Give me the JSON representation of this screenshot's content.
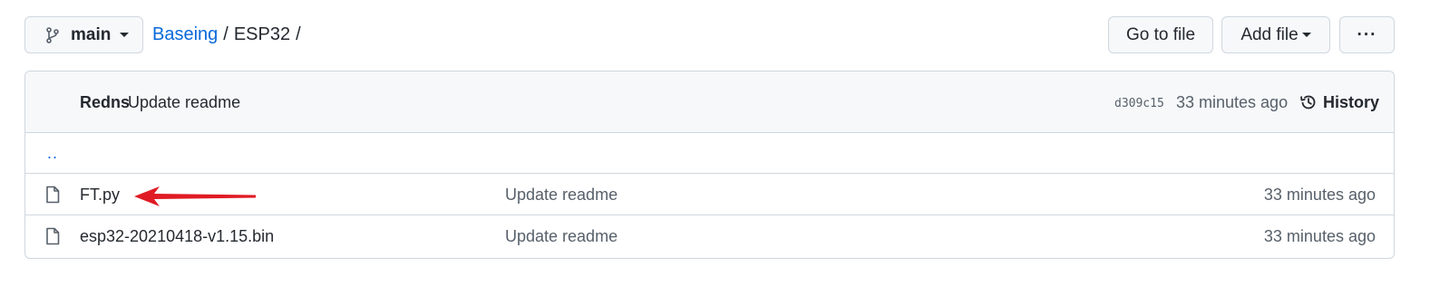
{
  "branch": {
    "name": "main"
  },
  "breadcrumb": {
    "repo": "Baseing",
    "separator": "/",
    "dir": "ESP32",
    "trailing": "/"
  },
  "actions": {
    "go_to_file": "Go to file",
    "add_file": "Add file",
    "more": "···"
  },
  "latest_commit": {
    "author": "Redns",
    "message": "Update readme",
    "sha": "d309c15",
    "time": "33 minutes ago",
    "history_label": "History"
  },
  "parent_dir": "..",
  "files": [
    {
      "name": "FT.py",
      "message": "Update readme",
      "time": "33 minutes ago"
    },
    {
      "name": "esp32-20210418-v1.15.bin",
      "message": "Update readme",
      "time": "33 minutes ago"
    }
  ],
  "colors": {
    "link": "#0969da",
    "annotation_arrow": "#e01b24",
    "border": "#d0d7de"
  },
  "icons": [
    "git-branch-icon",
    "caret-down-icon",
    "history-icon",
    "file-icon",
    "arrow-annotation"
  ]
}
